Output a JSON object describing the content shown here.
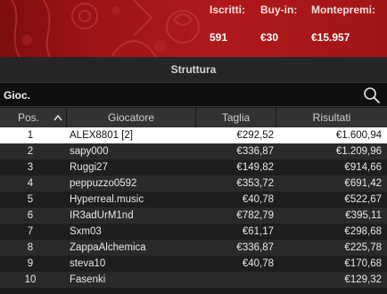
{
  "header": {
    "stats": [
      {
        "label": "Iscritti:",
        "value": "591"
      },
      {
        "label": "Buy-in:",
        "value": "€30"
      },
      {
        "label": "Montepremi:",
        "value": "€15.957"
      }
    ]
  },
  "section": {
    "title": "Struttura"
  },
  "search": {
    "placeholder": "Gioc."
  },
  "table": {
    "columns": [
      "Pos.",
      "Giocatore",
      "Taglia",
      "Risultati"
    ],
    "rows": [
      {
        "pos": "1",
        "name": "ALEX8801 [2]",
        "size": "€292,52",
        "result": "€1.600,94",
        "selected": true
      },
      {
        "pos": "2",
        "name": "sapy000",
        "size": "€336,87",
        "result": "€1.209,96"
      },
      {
        "pos": "3",
        "name": "Ruggi27",
        "size": "€149,82",
        "result": "€914,66"
      },
      {
        "pos": "4",
        "name": "peppuzzo0592",
        "size": "€353,72",
        "result": "€691,42"
      },
      {
        "pos": "5",
        "name": "Hyperreal.music",
        "size": "€40,78",
        "result": "€522,67"
      },
      {
        "pos": "6",
        "name": "IR3adUrM1nd",
        "size": "€782,79",
        "result": "€395,11"
      },
      {
        "pos": "7",
        "name": "Sxm03",
        "size": "€61,17",
        "result": "€298,68"
      },
      {
        "pos": "8",
        "name": "ZappaAlchemica",
        "size": "€336,87",
        "result": "€225,78"
      },
      {
        "pos": "9",
        "name": "steva10",
        "size": "€40,78",
        "result": "€170,68"
      },
      {
        "pos": "10",
        "name": "Fasenki",
        "size": "",
        "result": "€129,32"
      }
    ]
  }
}
